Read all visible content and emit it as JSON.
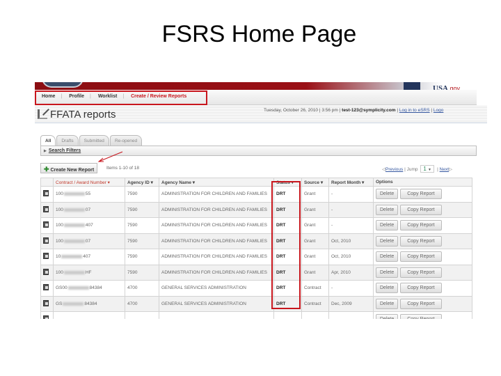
{
  "slide": {
    "title": "FSRS Home Page"
  },
  "nav": {
    "items": [
      {
        "label": "Home"
      },
      {
        "label": "Profile"
      },
      {
        "label": "Worklist"
      },
      {
        "label": "Create / Review Reports"
      }
    ],
    "active": "Create / Review Reports"
  },
  "logos": {
    "usa": "USA",
    "usa_suffix": ".gov"
  },
  "header": {
    "title": "FFATA reports",
    "date": "Tuesday, October 26, 2010 | 3:56 pm |",
    "user": "test-123@symplicity.com",
    "login_link": "Log in to eSRS",
    "logout_link": "Logo"
  },
  "tabs": [
    {
      "label": "All",
      "active": true
    },
    {
      "label": "Drafts"
    },
    {
      "label": "Submitted"
    },
    {
      "label": "Re-opened"
    }
  ],
  "filters": {
    "label": "Search Filters"
  },
  "actions": {
    "create_label": "Create New Report",
    "items_count": "Items 1-10 of 18"
  },
  "pager": {
    "previous": "Previous",
    "jump_label": "Jump",
    "jump_value": "1",
    "next": "Next"
  },
  "table": {
    "columns": [
      "",
      "Contract / Award Number",
      "Agency ID",
      "Agency Name",
      "Status",
      "Source",
      "Report Month",
      "Options"
    ],
    "rows": [
      {
        "award_prefix": "100",
        "award_suffix": "55",
        "agency_id": "7590",
        "agency_name": "ADMINISTRATION FOR CHILDREN AND FAMILIES",
        "status": "DRT",
        "source": "Grant",
        "month": "-"
      },
      {
        "award_prefix": "100",
        "award_suffix": "07",
        "agency_id": "7590",
        "agency_name": "ADMINISTRATION FOR CHILDREN AND FAMILIES",
        "status": "DRT",
        "source": "Grant",
        "month": "-"
      },
      {
        "award_prefix": "100",
        "award_suffix": "407",
        "agency_id": "7590",
        "agency_name": "ADMINISTRATION FOR CHILDREN AND FAMILIES",
        "status": "DRT",
        "source": "Grant",
        "month": "-"
      },
      {
        "award_prefix": "100",
        "award_suffix": "07",
        "agency_id": "7590",
        "agency_name": "ADMINISTRATION FOR CHILDREN AND FAMILIES",
        "status": "DRT",
        "source": "Grant",
        "month": "Oct, 2010"
      },
      {
        "award_prefix": "10",
        "award_suffix": "407",
        "agency_id": "7590",
        "agency_name": "ADMINISTRATION FOR CHILDREN AND FAMILIES",
        "status": "DRT",
        "source": "Grant",
        "month": "Oct, 2010"
      },
      {
        "award_prefix": "100",
        "award_suffix": "HF",
        "agency_id": "7590",
        "agency_name": "ADMINISTRATION FOR CHILDREN AND FAMILIES",
        "status": "DRT",
        "source": "Grant",
        "month": "Apr, 2010"
      },
      {
        "award_prefix": "GS00",
        "award_suffix": "84384",
        "agency_id": "4700",
        "agency_name": "GENERAL SERVICES ADMINISTRATION",
        "status": "DRT",
        "source": "Contract",
        "month": "-"
      },
      {
        "award_prefix": "GS",
        "award_suffix": "84384",
        "agency_id": "4700",
        "agency_name": "GENERAL SERVICES ADMINISTRATION",
        "status": "DRT",
        "source": "Contract",
        "month": "Dec, 2009"
      },
      {
        "award_prefix": "",
        "award_suffix": "",
        "agency_id": "",
        "agency_name": "",
        "status": "",
        "source": "",
        "month": ""
      }
    ],
    "delete_label": "Delete",
    "copy_label": "Copy Report"
  }
}
